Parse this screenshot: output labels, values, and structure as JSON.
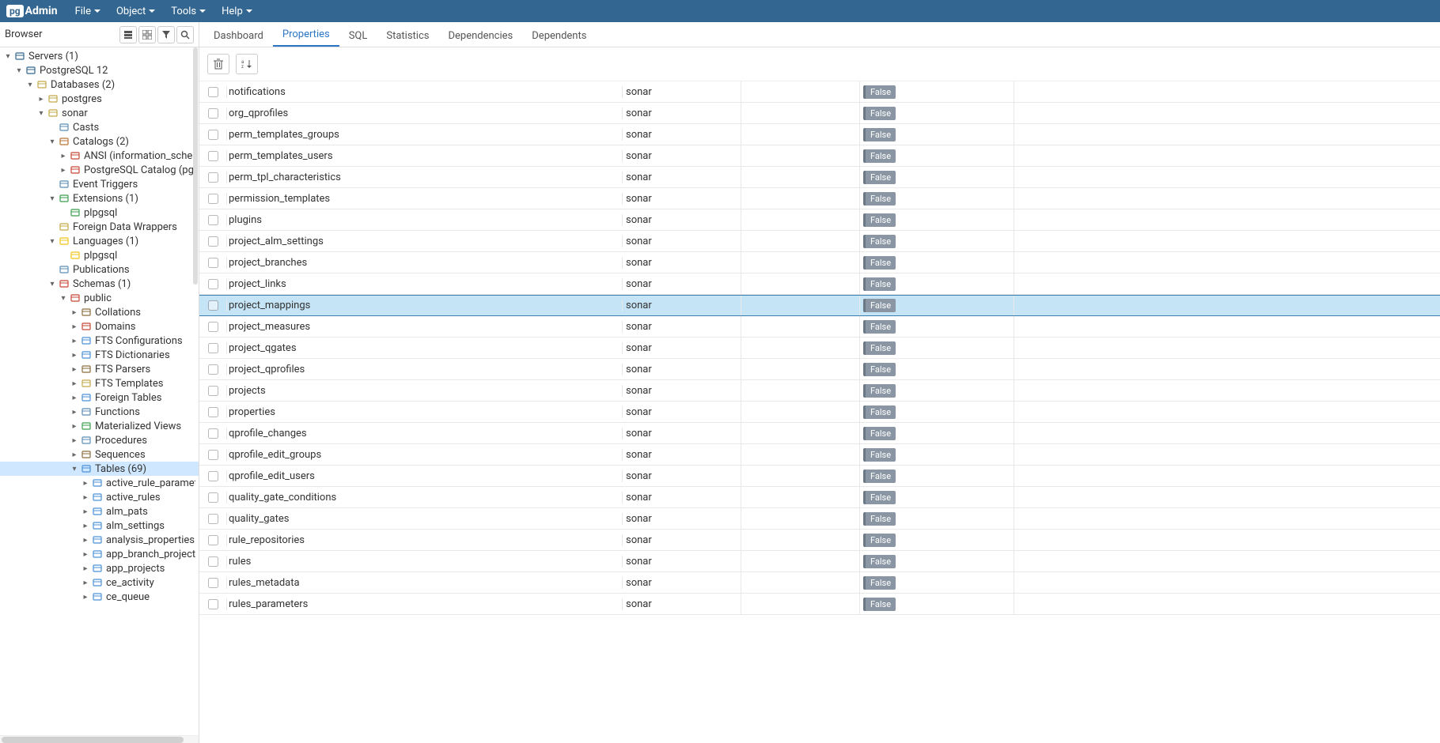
{
  "app": {
    "logo_prefix": "pg",
    "logo_text": "Admin"
  },
  "menubar": [
    "File",
    "Object",
    "Tools",
    "Help"
  ],
  "sidebar": {
    "title": "Browser",
    "tree": [
      {
        "d": 0,
        "t": "v",
        "ic": "srv",
        "l": "Servers (1)",
        "c": "#326690"
      },
      {
        "d": 1,
        "t": "v",
        "ic": "pg",
        "l": "PostgreSQL 12",
        "c": "#326690"
      },
      {
        "d": 2,
        "t": "v",
        "ic": "db",
        "l": "Databases (2)",
        "c": "#c5a847"
      },
      {
        "d": 3,
        "t": ">",
        "ic": "db",
        "l": "postgres",
        "c": "#c5a847"
      },
      {
        "d": 3,
        "t": "v",
        "ic": "db",
        "l": "sonar",
        "c": "#c5a847"
      },
      {
        "d": 4,
        "t": " ",
        "ic": "cast",
        "l": "Casts",
        "c": "#5b8db8"
      },
      {
        "d": 4,
        "t": "v",
        "ic": "cat",
        "l": "Catalogs (2)",
        "c": "#b87333"
      },
      {
        "d": 5,
        "t": ">",
        "ic": "cat",
        "l": "ANSI (information_schema)",
        "c": "#c74634"
      },
      {
        "d": 5,
        "t": ">",
        "ic": "cat",
        "l": "PostgreSQL Catalog (pg_catalog)",
        "c": "#c74634"
      },
      {
        "d": 4,
        "t": " ",
        "ic": "evt",
        "l": "Event Triggers",
        "c": "#5b8db8"
      },
      {
        "d": 4,
        "t": "v",
        "ic": "ext",
        "l": "Extensions (1)",
        "c": "#3a9e4c"
      },
      {
        "d": 5,
        "t": " ",
        "ic": "ext",
        "l": "plpgsql",
        "c": "#3a9e4c"
      },
      {
        "d": 4,
        "t": " ",
        "ic": "fdw",
        "l": "Foreign Data Wrappers",
        "c": "#c5a847"
      },
      {
        "d": 4,
        "t": "v",
        "ic": "lang",
        "l": "Languages (1)",
        "c": "#f0c419"
      },
      {
        "d": 5,
        "t": " ",
        "ic": "lang",
        "l": "plpgsql",
        "c": "#f0c419"
      },
      {
        "d": 4,
        "t": " ",
        "ic": "pub",
        "l": "Publications",
        "c": "#5b8db8"
      },
      {
        "d": 4,
        "t": "v",
        "ic": "sch",
        "l": "Schemas (1)",
        "c": "#c74634"
      },
      {
        "d": 5,
        "t": "v",
        "ic": "sch",
        "l": "public",
        "c": "#c74634"
      },
      {
        "d": 6,
        "t": ">",
        "ic": "col",
        "l": "Collations",
        "c": "#8a6d3b"
      },
      {
        "d": 6,
        "t": ">",
        "ic": "dom",
        "l": "Domains",
        "c": "#c74634"
      },
      {
        "d": 6,
        "t": ">",
        "ic": "fts",
        "l": "FTS Configurations",
        "c": "#4a90d9"
      },
      {
        "d": 6,
        "t": ">",
        "ic": "fts",
        "l": "FTS Dictionaries",
        "c": "#4a90d9"
      },
      {
        "d": 6,
        "t": ">",
        "ic": "fts",
        "l": "FTS Parsers",
        "c": "#8a6d3b"
      },
      {
        "d": 6,
        "t": ">",
        "ic": "fts",
        "l": "FTS Templates",
        "c": "#c5a847"
      },
      {
        "d": 6,
        "t": ">",
        "ic": "ftb",
        "l": "Foreign Tables",
        "c": "#4a90d9"
      },
      {
        "d": 6,
        "t": ">",
        "ic": "fn",
        "l": "Functions",
        "c": "#5b8db8"
      },
      {
        "d": 6,
        "t": ">",
        "ic": "mv",
        "l": "Materialized Views",
        "c": "#3a9e4c"
      },
      {
        "d": 6,
        "t": ">",
        "ic": "prc",
        "l": "Procedures",
        "c": "#5b8db8"
      },
      {
        "d": 6,
        "t": ">",
        "ic": "seq",
        "l": "Sequences",
        "c": "#8a6d3b"
      },
      {
        "d": 6,
        "t": "v",
        "ic": "tbl",
        "l": "Tables (69)",
        "c": "#4a90d9",
        "sel": true
      },
      {
        "d": 7,
        "t": ">",
        "ic": "tbl",
        "l": "active_rule_parameters",
        "c": "#4a90d9"
      },
      {
        "d": 7,
        "t": ">",
        "ic": "tbl",
        "l": "active_rules",
        "c": "#4a90d9"
      },
      {
        "d": 7,
        "t": ">",
        "ic": "tbl",
        "l": "alm_pats",
        "c": "#4a90d9"
      },
      {
        "d": 7,
        "t": ">",
        "ic": "tbl",
        "l": "alm_settings",
        "c": "#4a90d9"
      },
      {
        "d": 7,
        "t": ">",
        "ic": "tbl",
        "l": "analysis_properties",
        "c": "#4a90d9"
      },
      {
        "d": 7,
        "t": ">",
        "ic": "tbl",
        "l": "app_branch_project_branch",
        "c": "#4a90d9"
      },
      {
        "d": 7,
        "t": ">",
        "ic": "tbl",
        "l": "app_projects",
        "c": "#4a90d9"
      },
      {
        "d": 7,
        "t": ">",
        "ic": "tbl",
        "l": "ce_activity",
        "c": "#4a90d9"
      },
      {
        "d": 7,
        "t": ">",
        "ic": "tbl",
        "l": "ce_queue",
        "c": "#4a90d9"
      }
    ]
  },
  "tabs": [
    {
      "label": "Dashboard",
      "active": false
    },
    {
      "label": "Properties",
      "active": true
    },
    {
      "label": "SQL",
      "active": false
    },
    {
      "label": "Statistics",
      "active": false
    },
    {
      "label": "Dependencies",
      "active": false
    },
    {
      "label": "Dependents",
      "active": false
    }
  ],
  "grid": {
    "badge_label": "False",
    "owner": "sonar",
    "selected_index": 10,
    "rows": [
      "notifications",
      "org_qprofiles",
      "perm_templates_groups",
      "perm_templates_users",
      "perm_tpl_characteristics",
      "permission_templates",
      "plugins",
      "project_alm_settings",
      "project_branches",
      "project_links",
      "project_mappings",
      "project_measures",
      "project_qgates",
      "project_qprofiles",
      "projects",
      "properties",
      "qprofile_changes",
      "qprofile_edit_groups",
      "qprofile_edit_users",
      "quality_gate_conditions",
      "quality_gates",
      "rule_repositories",
      "rules",
      "rules_metadata",
      "rules_parameters"
    ]
  }
}
